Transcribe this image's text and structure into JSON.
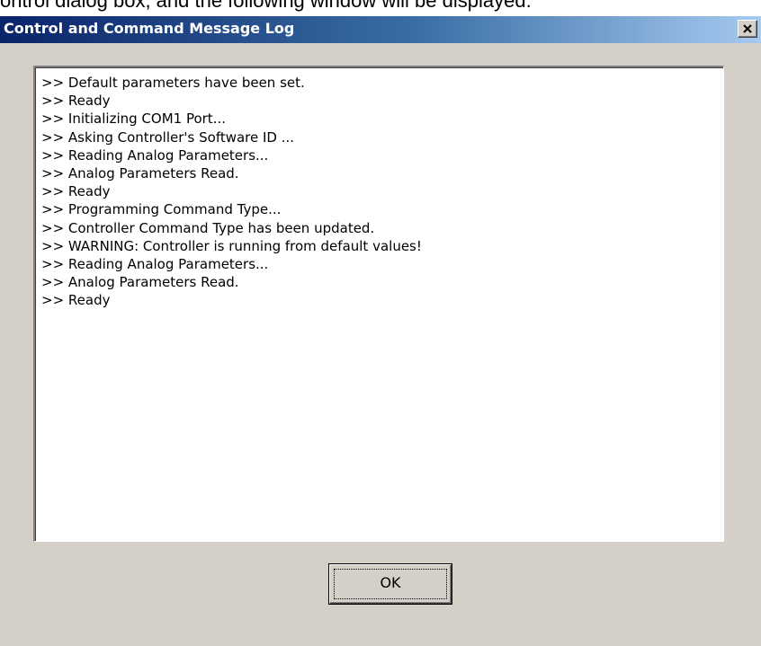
{
  "caption_fragment": "ontrol dialog box, and the following window will be displayed:",
  "window": {
    "title": "Control and Command Message Log",
    "close_icon": "close-x-icon"
  },
  "log": {
    "lines": [
      ">> Default parameters have been set.",
      ">> Ready",
      ">> Initializing COM1 Port...",
      ">> Asking Controller's Software ID ...",
      ">> Reading Analog Parameters...",
      ">> Analog Parameters Read.",
      ">> Ready",
      ">> Programming Command Type...",
      ">> Controller Command Type has been updated.",
      ">> WARNING: Controller is running from default values!",
      ">> Reading Analog Parameters...",
      ">> Analog Parameters Read.",
      ">> Ready"
    ]
  },
  "buttons": {
    "ok_label": "OK"
  },
  "colors": {
    "titlebar_start": "#0a246a",
    "titlebar_end": "#a6caf0",
    "dialog_face": "#d4d0c8"
  }
}
